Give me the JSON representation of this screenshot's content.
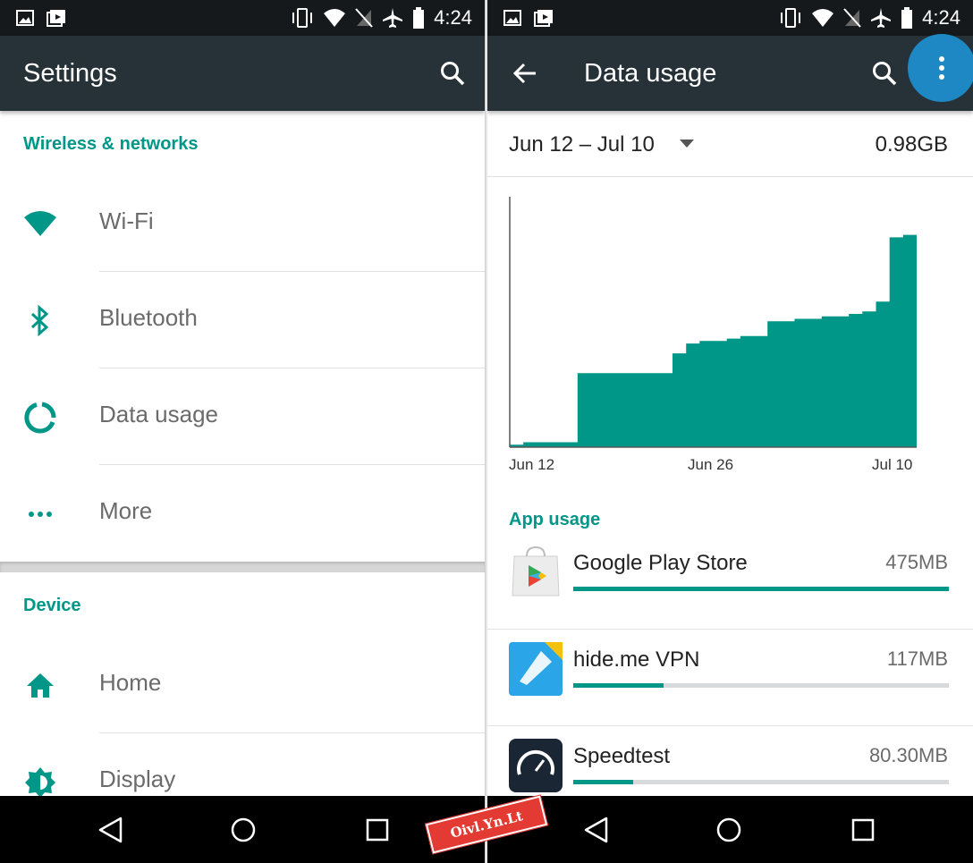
{
  "status_bar": {
    "time": "4:24"
  },
  "left": {
    "toolbar": {
      "title": "Settings"
    },
    "sections": {
      "wireless_header": "Wireless & networks",
      "device_header": "Device"
    },
    "items": {
      "wifi": "Wi-Fi",
      "bluetooth": "Bluetooth",
      "data_usage": "Data usage",
      "more": "More",
      "home": "Home",
      "display": "Display"
    }
  },
  "right": {
    "toolbar": {
      "title": "Data usage"
    },
    "cycle": {
      "range": "Jun 12 – Jul 10",
      "total": "0.98GB"
    },
    "app_usage_header": "App usage",
    "apps": [
      {
        "name": "Google Play Store",
        "size": "475MB",
        "fraction": 1.0
      },
      {
        "name": "hide.me VPN",
        "size": "117MB",
        "fraction": 0.24
      },
      {
        "name": "Speedtest",
        "size": "80.30MB",
        "fraction": 0.16
      }
    ]
  },
  "chart_data": {
    "type": "area",
    "x_ticks": [
      "Jun 12",
      "Jun 26",
      "Jul 10"
    ],
    "series": [
      {
        "values": [
          0.01,
          0.02,
          0.02,
          0.02,
          0.02,
          0.3,
          0.3,
          0.3,
          0.3,
          0.3,
          0.3,
          0.3,
          0.38,
          0.42,
          0.43,
          0.43,
          0.44,
          0.45,
          0.45,
          0.51,
          0.51,
          0.52,
          0.52,
          0.53,
          0.53,
          0.54,
          0.55,
          0.59,
          0.85,
          0.86
        ]
      }
    ],
    "grid": false
  },
  "watermark": "Oivl.Yn.Lt"
}
